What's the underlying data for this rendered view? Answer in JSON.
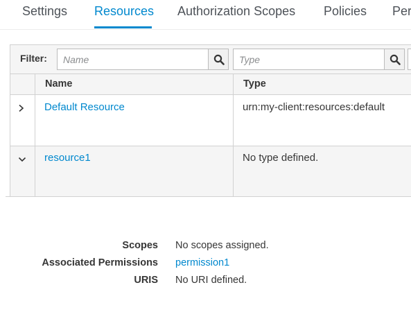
{
  "tabs": [
    {
      "label": "Settings"
    },
    {
      "label": "Resources"
    },
    {
      "label": "Authorization Scopes"
    },
    {
      "label": "Policies"
    },
    {
      "label": "Per"
    }
  ],
  "filter": {
    "label": "Filter:",
    "name_placeholder": "Name",
    "type_placeholder": "Type"
  },
  "table": {
    "headers": {
      "name": "Name",
      "type": "Type"
    },
    "rows": [
      {
        "name": "Default Resource",
        "type": "urn:my-client:resources:default",
        "expanded": false
      },
      {
        "name": "resource1",
        "type": "No type defined.",
        "expanded": true
      }
    ]
  },
  "details": {
    "scopes_label": "Scopes",
    "scopes_value": "No scopes assigned.",
    "permissions_label": "Associated Permissions",
    "permissions_value": "permission1",
    "uris_label": "URIS",
    "uris_value": "No URI defined."
  },
  "colors": {
    "accent": "#0088ce",
    "text": "#363636",
    "border": "#d1d1d1",
    "header_bg": "#f5f5f5"
  },
  "icons": {
    "search": "search-icon",
    "collapsed": "chevron-right-icon",
    "expanded": "chevron-down-icon"
  }
}
